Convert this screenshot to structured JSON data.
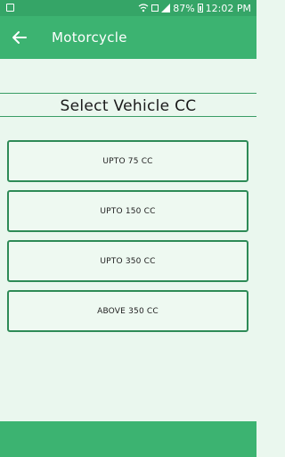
{
  "status_bar": {
    "battery_percent": "87%",
    "time": "12:02 PM"
  },
  "app_bar": {
    "title": "Motorcycle",
    "back_icon": "arrow-left-icon"
  },
  "heading": "Select Vehicle CC",
  "options": [
    {
      "label": "UPTO 75 CC"
    },
    {
      "label": "UPTO 150 CC"
    },
    {
      "label": "UPTO 350 CC"
    },
    {
      "label": "ABOVE 350 CC"
    }
  ],
  "colors": {
    "accent": "#3cb371",
    "border": "#2e8b57",
    "background": "#eaf7ee"
  }
}
